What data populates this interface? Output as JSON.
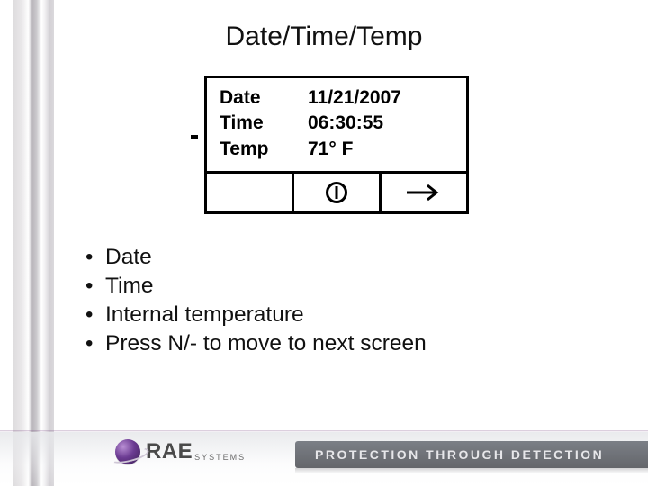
{
  "title": "Date/Time/Temp",
  "lcd": {
    "rows": [
      {
        "label": "Date",
        "value": "11/21/2007"
      },
      {
        "label": "Time",
        "value": "06:30:55"
      },
      {
        "label": "Temp",
        "value": "71° F"
      }
    ],
    "buttons": {
      "left": "",
      "middle_icon": "record-icon",
      "right_icon": "arrow-right-icon"
    }
  },
  "bullets": [
    "Date",
    "Time",
    "Internal temperature",
    "Press N/- to move to next screen"
  ],
  "footer": {
    "logo_main": "RAE",
    "logo_sub": "SYSTEMS",
    "tagline": "PROTECTION THROUGH DETECTION"
  }
}
